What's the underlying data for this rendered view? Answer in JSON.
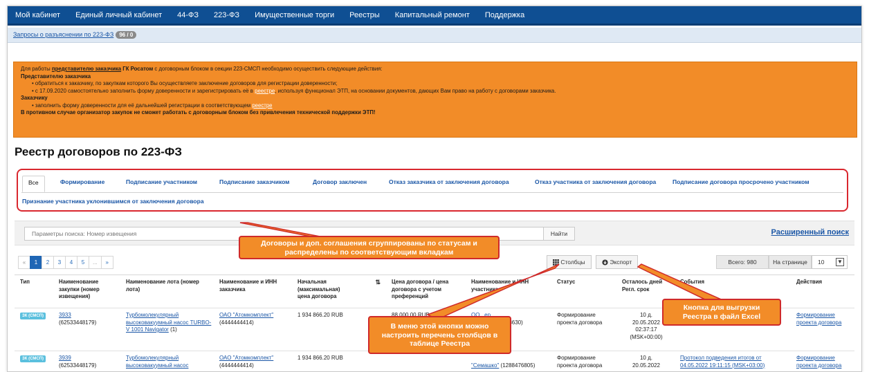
{
  "nav": {
    "items": [
      "Мой кабинет",
      "Единый личный кабинет",
      "44-ФЗ",
      "223-ФЗ",
      "Имущественные торги",
      "Реестры",
      "Капитальный ремонт",
      "Поддержка"
    ]
  },
  "subnav": {
    "link": "Запросы о разъяснении по 223-ФЗ",
    "badge": "96 / 0"
  },
  "alert": {
    "line1_pre": "Для работы ",
    "line1_link": "представителю заказчика",
    "line1_bold": " ГК Росатом",
    "line1_post": " с договорным блоком в секции 223-СМСП необходимо осуществить следующие действия:",
    "rep_head": "Представителю заказчика",
    "rep_item1": "• обратиться к заказчику, по закупкам которого Вы осуществляете заключение договоров для регистрации доверенности;",
    "rep_item2_pre": "• с 17.09.2020 самостоятельно заполнить форму доверенности и зарегистрировать её в ",
    "rep_item2_link": "реестре",
    "rep_item2_post": ", используя функционал ЭТП, на основании документов, дающих Вам право на работу с договорами заказчика.",
    "cust_head": "Заказчику",
    "cust_item1_pre": "• заполнить форму доверенности для её дальнейшей регистрации в соответствующем ",
    "cust_item1_link": "реестре",
    "warning": "В противном случае организатор закупок не сможет работать с договорным блоком без привлечения технической поддержки ЭТП!"
  },
  "page": {
    "title": "Реестр договоров по 223-ФЗ"
  },
  "tabs": [
    "Все",
    "Формирование",
    "Подписание участником",
    "Подписание заказчиком",
    "Договор заключен",
    "Отказ заказчика от заключения договора",
    "Отказ участника от заключения договора",
    "Подписание договора просрочено участником",
    "Признание участника уклонившимся от заключения договора"
  ],
  "search": {
    "placeholder": "Параметры поиска: Номер извещения",
    "button": "Найти",
    "advanced": "Расширенный поиск"
  },
  "pager": {
    "prev": "«",
    "pages": [
      "1",
      "2",
      "3",
      "4",
      "5"
    ],
    "ellipsis": "...",
    "next": "»"
  },
  "toolbar": {
    "columns": "Столбцы",
    "export": "Экспорт",
    "total": "Всего: 980",
    "per_page_label": "На странице",
    "per_page_value": "10"
  },
  "table": {
    "headers": {
      "type": "Тип",
      "proc": "Наименование закупки (номер извещения)",
      "lot": "Наименование лота (номер лота)",
      "cust": "Наименование и ИНН заказчика",
      "price": "Начальная (максимальная) цена договора",
      "contract": "Цена договора / цена договора с учетом преференций",
      "part": "Наименование и ИНН участника",
      "status": "Статус",
      "left": "Осталось дней Регл. срок",
      "events": "События",
      "actions": "Действия"
    },
    "rows": [
      {
        "type": "ЗК (СМСП)",
        "proc_link": "3933",
        "proc_num": "(62533448179)",
        "lot_link": "Турбомолекулярный высоковакуумный насос TURBO-V 1001 Navigator",
        "lot_num": "(1)",
        "cust_link": "ОАО \"Атомкомплект\"",
        "cust_inn": "(4444444414)",
        "price": "1 934 866.20 RUB",
        "contract": "88 000.00 RUB",
        "part_link": "ОО...ер",
        "part_inn": "(...8630)",
        "status": "Формирование проекта договора",
        "days": "10 д.",
        "date": "20.05.2022",
        "time": "02:37:17",
        "tz": "(MSK+00:00)",
        "event": "",
        "action": "Формирование проекта договора"
      },
      {
        "type": "ЗК (СМСП)",
        "proc_link": "3939",
        "proc_num": "(62533448179)",
        "lot_link": "Турбомолекулярный высоковакуумный насос",
        "lot_num": "",
        "cust_link": "ОАО \"Атомкомплект\"",
        "cust_inn": "(4444444414)",
        "price": "1 934 866.20 RUB",
        "contract": "",
        "part_link": "\"Семашко\"",
        "part_inn": "(1288476805)",
        "status": "Формирование проекта договора",
        "days": "10 д.",
        "date": "20.05.2022",
        "time": "",
        "tz": "",
        "event": "Протокол подведения итогов от 04.05.2022 19:11:15 (MSK+03:00)",
        "action": "Формирование проекта договора"
      }
    ]
  },
  "callouts": {
    "tabs_note": "Договоры и доп. соглашения сгруппированы по статусам и распределены по соответствующим вкладкам",
    "columns_note": "В меню этой кнопки можно настроить перечень столбцов в таблице Реестра",
    "export_note": "Кнопка для выгрузки Реестра в файл Excel"
  },
  "colors": {
    "nav": "#0f4f93",
    "alert": "#f28c28",
    "callout_border": "#cf2a2a",
    "link": "#1a56a6",
    "badge": "#5bc0de"
  }
}
